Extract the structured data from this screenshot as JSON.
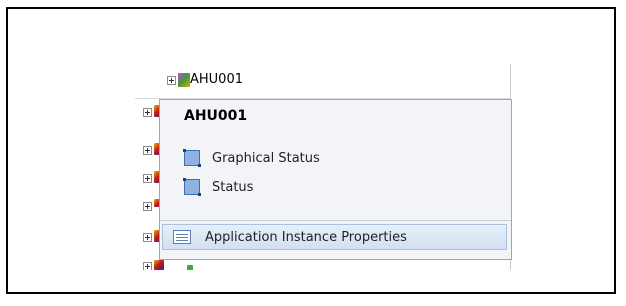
{
  "tree": {
    "node_label": "AHU001"
  },
  "popup": {
    "title": "AHU001",
    "items": [
      {
        "label": "Graphical Status",
        "icon": "status-square-icon"
      },
      {
        "label": "Status",
        "icon": "status-square-icon"
      }
    ],
    "highlighted_item": {
      "label": "Application Instance Properties",
      "icon": "list-icon"
    }
  },
  "colors": {
    "highlight_background": "#d2e0f3",
    "popup_background": "#f2f4f8",
    "border": "#000000"
  }
}
